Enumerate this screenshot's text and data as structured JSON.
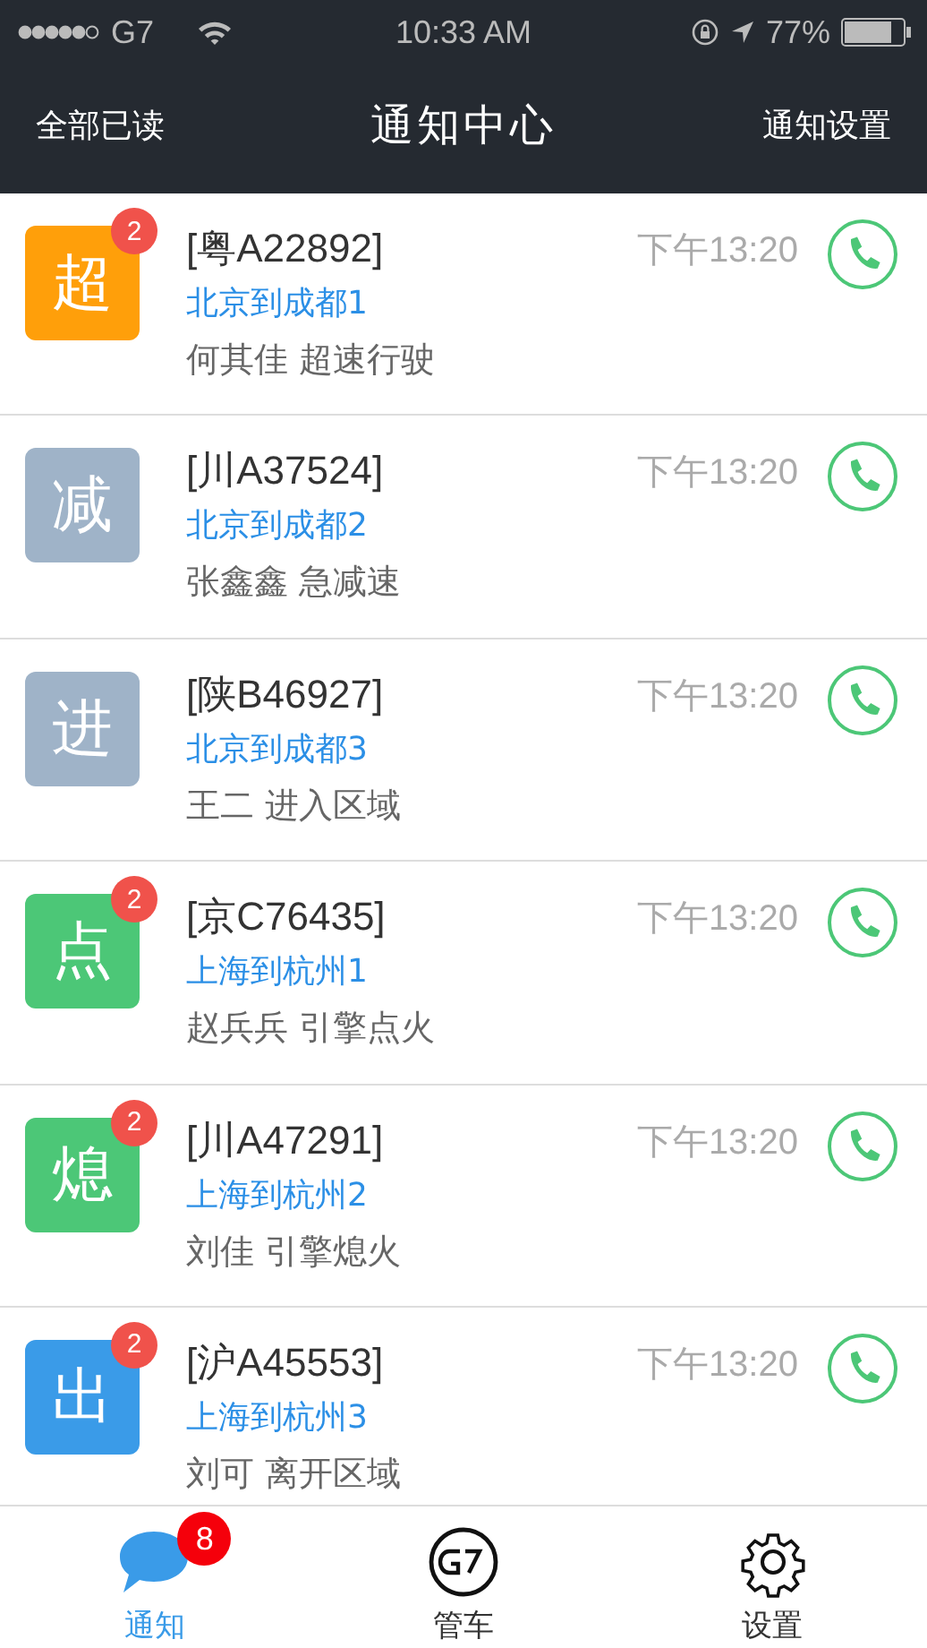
{
  "status_bar": {
    "carrier": "G7",
    "time": "10:33 AM",
    "battery": "77%"
  },
  "nav": {
    "left": "全部已读",
    "title": "通知中心",
    "right": "通知设置"
  },
  "notifications": [
    {
      "icon_text": "超",
      "color": "#ff9f0a",
      "badge": "2",
      "plate": "[粤A22892]",
      "route": "北京到成都1",
      "detail": "何其佳 超速行驶",
      "time": "下午13:20"
    },
    {
      "icon_text": "减",
      "color": "#9fb3c8",
      "plate": "[川A37524]",
      "route": "北京到成都2",
      "detail": "张鑫鑫 急减速",
      "time": "下午13:20"
    },
    {
      "icon_text": "进",
      "color": "#9fb3c8",
      "plate": "[陕B46927]",
      "route": "北京到成都3",
      "detail": "王二 进入区域",
      "time": "下午13:20"
    },
    {
      "icon_text": "点",
      "color": "#4cc777",
      "badge": "2",
      "plate": "[京C76435]",
      "route": "上海到杭州1",
      "detail": "赵兵兵 引擎点火",
      "time": "下午13:20"
    },
    {
      "icon_text": "熄",
      "color": "#4cc777",
      "badge": "2",
      "plate": "[川A47291]",
      "route": "上海到杭州2",
      "detail": "刘佳 引擎熄火",
      "time": "下午13:20"
    },
    {
      "icon_text": "出",
      "color": "#3a9be8",
      "badge": "2",
      "plate": "[沪A45553]",
      "route": "上海到杭州3",
      "detail": "刘可 离开区域",
      "time": "下午13:20"
    }
  ],
  "tabs": [
    {
      "kind": "chat",
      "label": "通知",
      "selected": true,
      "badge": "8"
    },
    {
      "kind": "logo",
      "label": "管车",
      "selected": false
    },
    {
      "kind": "gear",
      "label": "设置",
      "selected": false
    }
  ]
}
